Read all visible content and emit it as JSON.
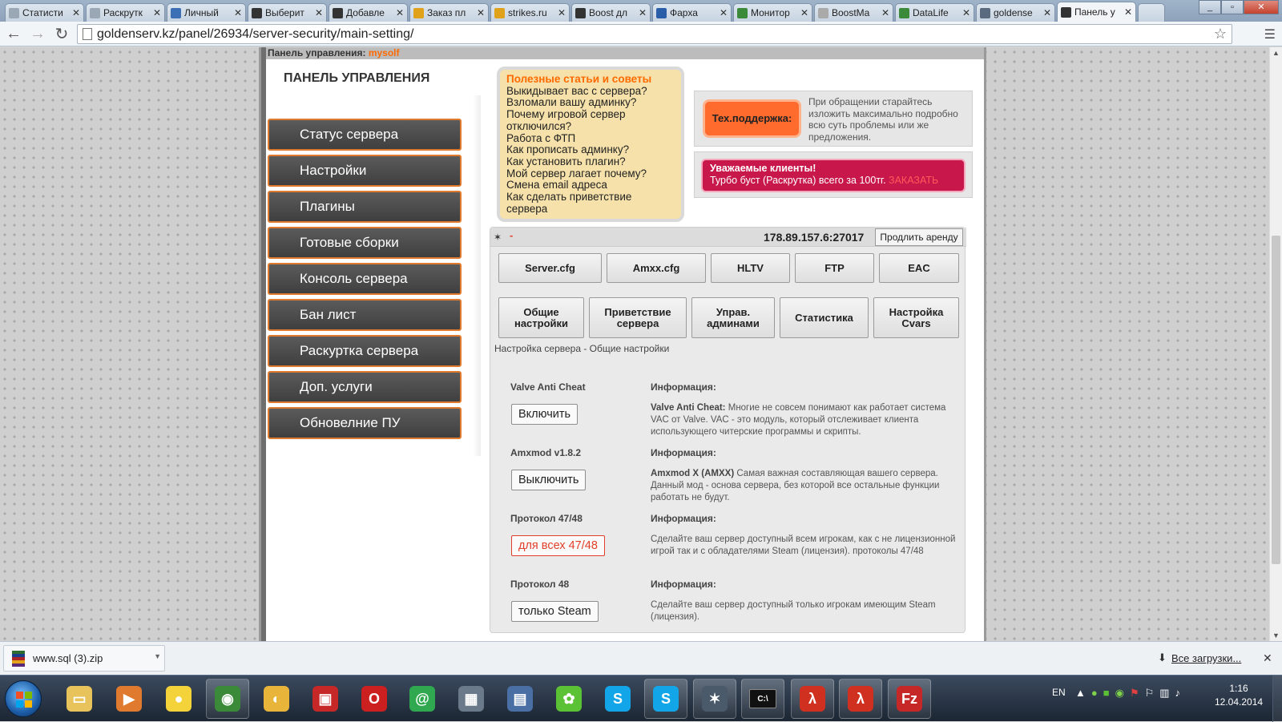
{
  "browser": {
    "tabs": [
      {
        "label": "Статисти",
        "icon": "page-icon",
        "color": "#9aa7b5"
      },
      {
        "label": "Раскрутк",
        "icon": "page-icon",
        "color": "#9aa7b5"
      },
      {
        "label": "Личный",
        "icon": "folder-icon",
        "color": "#3d6fb5"
      },
      {
        "label": "Выберит",
        "icon": "counter-strike-icon",
        "color": "#333333"
      },
      {
        "label": "Добавле",
        "icon": "counter-strike-icon",
        "color": "#333333"
      },
      {
        "label": "Заказ пл",
        "icon": "globe-icon",
        "color": "#e0a21a"
      },
      {
        "label": "strikes.ru",
        "icon": "globe-icon",
        "color": "#e0a21a"
      },
      {
        "label": "Boost дл",
        "icon": "counter-strike-icon",
        "color": "#333333"
      },
      {
        "label": "Фарха",
        "icon": "video-icon",
        "color": "#2b5ea8"
      },
      {
        "label": "Монитор",
        "icon": "counter-strike-icon",
        "color": "#3a8a3a"
      },
      {
        "label": "BoostMa",
        "icon": "loading-icon",
        "color": "#aaaaaa"
      },
      {
        "label": "DataLife",
        "icon": "counter-strike-icon",
        "color": "#3a8a3a"
      },
      {
        "label": "goldense",
        "icon": "payment-icon",
        "color": "#5a6b80"
      },
      {
        "label": "Панель у",
        "icon": "counter-strike-icon",
        "color": "#333333"
      }
    ],
    "url": "goldenserv.kz/panel/26934/server-security/main-setting/"
  },
  "panel": {
    "topbar_label": "Панель управления:",
    "topbar_user": "mysolf",
    "title": "ПАНЕЛЬ УПРАВЛЕНИЯ",
    "menu": [
      "Статус сервера",
      "Настройки",
      "Плагины",
      "Готовые сборки",
      "Консоль сервера",
      "Бан лист",
      "Раскуртка сервера",
      "Доп. услуги",
      "Обновелние ПУ"
    ]
  },
  "tips": {
    "title": "Полезные статьи и советы",
    "items": [
      "Выкидывает вас с сервера?",
      "Взломали вашу админку?",
      "Почему игровой сервер отключился?",
      "Работа с ФТП",
      "Как прописать админку?",
      "Как установить плагин?",
      "Мой сервер лагает почему?",
      "Смена email адреса",
      "Как сделать приветствие сервера"
    ]
  },
  "support": {
    "button": "Тех.поддержка:",
    "text": "При обращении старайтесь изложить максимально подробно всю суть проблемы или же предложения."
  },
  "promo": {
    "title": "Уважаемые клиенты!",
    "text": "Турбо буст (Раскрутка) всего за 100тг.",
    "order": "ЗАКАЗАТЬ"
  },
  "server": {
    "name_dash": "-",
    "ip": "178.89.157.6:27017",
    "renew": "Продлить аренду",
    "files": [
      "Server.cfg",
      "Amxx.cfg",
      "HLTV",
      "FTP",
      "EAC"
    ],
    "sections": [
      "Общие настройки",
      "Приветствие сервера",
      "Управ. админами",
      "Статистика",
      "Настройка Cvars"
    ],
    "breadcrumb": "Настройка сервера - Общие настройки",
    "info_heading": "Информация:",
    "settings": [
      {
        "label": "Valve Anti Cheat",
        "button": "Включить",
        "info_bold": "Valve Anti Cheat:",
        "info": "Многие не совсем понимают как работает система VAC от Valve. VAC - это модуль, который отслеживает клиента использующего читерские программы и скрипты."
      },
      {
        "label": "Amxmod v1.8.2",
        "button": "Выключить",
        "info_bold": "Amxmod X (AMXX)",
        "info": "Самая важная составляющая вашего сервера. Данный мод - основа сервера, без которой все остальные функции работать не будут."
      },
      {
        "label": "Протокол 47/48",
        "button": "для всех 47/48",
        "info_bold": "",
        "info": "Сделайте ваш сервер доступный всем игрокам, как с не лицензионной игрой так и с обладателями Steam (лицензия). протоколы 47/48"
      },
      {
        "label": "Протокол 48",
        "button": "только Steam",
        "info_bold": "",
        "info": "Сделайте ваш сервер доступный только игрокам имеющим Steam (лицензия)."
      }
    ]
  },
  "downloads": {
    "file": "www.sql (3).zip",
    "all": "Все загрузки..."
  },
  "taskbar": {
    "apps": [
      {
        "name": "explorer-icon",
        "color": "#e8c25a",
        "glyph": "▭",
        "open": false
      },
      {
        "name": "media-player-icon",
        "color": "#e07a2e",
        "glyph": "▶",
        "open": false
      },
      {
        "name": "chick-icon",
        "color": "#f4d23a",
        "glyph": "●",
        "open": false
      },
      {
        "name": "chrome-icon",
        "color": "#3a8a3a",
        "glyph": "◉",
        "open": true
      },
      {
        "name": "pidgin-icon",
        "color": "#e8b43a",
        "glyph": "◐",
        "open": false
      },
      {
        "name": "game-icon",
        "color": "#c62828",
        "glyph": "▣",
        "open": false
      },
      {
        "name": "opera-icon",
        "color": "#cc1f1f",
        "glyph": "O",
        "open": false
      },
      {
        "name": "mail-agent-icon",
        "color": "#2fa84f",
        "glyph": "@",
        "open": false
      },
      {
        "name": "network-icon",
        "color": "#6b7a8a",
        "glyph": "▦",
        "open": false
      },
      {
        "name": "remote-desktop-icon",
        "color": "#4a6fa5",
        "glyph": "▤",
        "open": false
      },
      {
        "name": "icq-icon",
        "color": "#5bc236",
        "glyph": "✿",
        "open": false
      },
      {
        "name": "skype-icon",
        "color": "#12a5e8",
        "glyph": "S",
        "open": false
      },
      {
        "name": "skype-second-icon",
        "color": "#12a5e8",
        "glyph": "S",
        "open": true
      },
      {
        "name": "counter-strike-icon",
        "color": "#4a5a6a",
        "glyph": "✶",
        "open": true
      },
      {
        "name": "command-prompt-icon",
        "color": "#111111",
        "glyph": "C:\\",
        "open": true
      },
      {
        "name": "half-life-icon",
        "color": "#d03020",
        "glyph": "λ",
        "open": true
      },
      {
        "name": "half-life-second-icon",
        "color": "#d03020",
        "glyph": "λ",
        "open": true
      },
      {
        "name": "filezilla-icon",
        "color": "#c62828",
        "glyph": "Fz",
        "open": true
      }
    ],
    "lang": "EN",
    "time": "1:16",
    "date": "12.04.2014"
  }
}
